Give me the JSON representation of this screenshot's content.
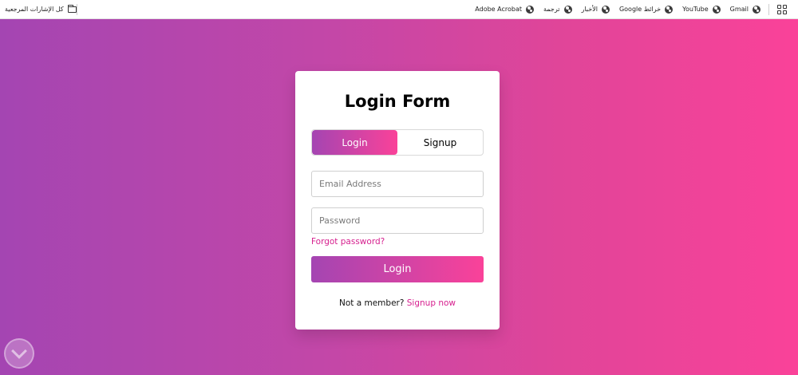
{
  "bookmarks": {
    "items": [
      {
        "label": "Gmail",
        "icon": "globe-icon"
      },
      {
        "label": "YouTube",
        "icon": "globe-icon"
      },
      {
        "label": "خرائط Google",
        "icon": "globe-icon"
      },
      {
        "label": "الأخبار",
        "icon": "globe-icon"
      },
      {
        "label": "ترجمة",
        "icon": "globe-icon"
      },
      {
        "label": "Adobe Acrobat",
        "icon": "globe-icon"
      }
    ],
    "all_bookmarks_label": "كل الإشارات المرجعية"
  },
  "login_form": {
    "title": "Login Form",
    "tabs": [
      {
        "label": "Login",
        "active": true
      },
      {
        "label": "Signup",
        "active": false
      }
    ],
    "email_placeholder": "Email Address",
    "email_value": "",
    "password_placeholder": "Password",
    "password_value": "",
    "forgot_link": "Forgot password?",
    "submit_label": "Login",
    "not_member_text": "Not a member?",
    "signup_link": "Signup now"
  },
  "colors": {
    "gradient_start": "#a445b2",
    "gradient_end": "#fa4299",
    "link": "#d61f8e"
  }
}
